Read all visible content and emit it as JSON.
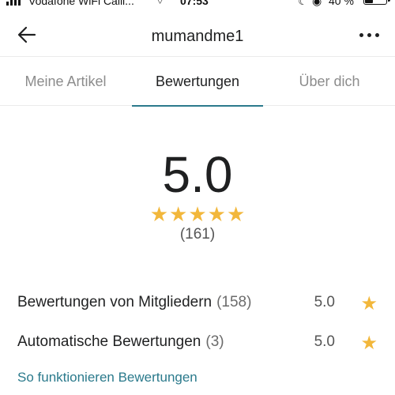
{
  "status_bar": {
    "carrier": "Vodafone WiFi Calli...",
    "time": "07:53",
    "battery_percent_text": "40 %",
    "battery_level": 0.4,
    "icons": [
      "signal-icon",
      "wifi-icon",
      "moon-icon",
      "rotation-lock-icon",
      "battery-icon"
    ]
  },
  "header": {
    "title": "mumandme1",
    "back_icon": "arrow-left-icon",
    "more_icon": "more-horizontal-icon"
  },
  "tabs": [
    {
      "label": "Meine Artikel",
      "active": false
    },
    {
      "label": "Bewertungen",
      "active": true
    },
    {
      "label": "Über dich",
      "active": false
    }
  ],
  "summary": {
    "score": "5.0",
    "stars": 5,
    "count": "(161)"
  },
  "breakdown": [
    {
      "label": "Bewertungen von Mitgliedern",
      "count": "(158)",
      "score": "5.0"
    },
    {
      "label": "Automatische Bewertungen",
      "count": "(3)",
      "score": "5.0"
    }
  ],
  "help_link": "So funktionieren Bewertungen",
  "colors": {
    "accent": "#2b7a8c",
    "star": "#f2b73b",
    "text": "#1f2021",
    "muted": "#8c8c8c"
  }
}
